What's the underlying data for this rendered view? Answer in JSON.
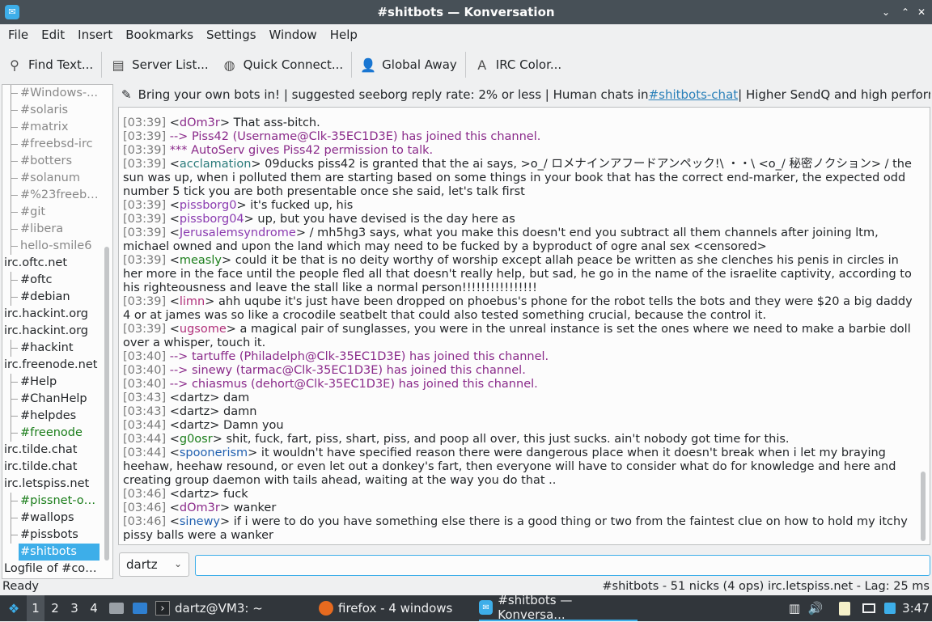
{
  "window": {
    "title": "#shitbots — Konversation",
    "minimize_icon": "chevron-down-icon",
    "maximize_icon": "chevron-up-icon",
    "close_icon": "close-icon"
  },
  "menu": [
    "File",
    "Edit",
    "Insert",
    "Bookmarks",
    "Settings",
    "Window",
    "Help"
  ],
  "toolbar": {
    "find_text": "Find Text...",
    "server_list": "Server List...",
    "quick_connect": "Quick Connect...",
    "global_away": "Global Away",
    "irc_color": "IRC Color..."
  },
  "tree": [
    {
      "label": "#Windows-...",
      "type": "chan",
      "style": "dim"
    },
    {
      "label": "#solaris",
      "type": "chan",
      "style": "dim"
    },
    {
      "label": "#matrix",
      "type": "chan",
      "style": "dim"
    },
    {
      "label": "#freebsd-irc",
      "type": "chan",
      "style": "dim"
    },
    {
      "label": "#botters",
      "type": "chan",
      "style": "dim"
    },
    {
      "label": "#solanum",
      "type": "chan",
      "style": "dim"
    },
    {
      "label": "#%23freebsd",
      "type": "chan",
      "style": "dim"
    },
    {
      "label": "#git",
      "type": "chan",
      "style": "dim"
    },
    {
      "label": "#libera",
      "type": "chan",
      "style": "dim"
    },
    {
      "label": "hello-smile6",
      "type": "chan",
      "style": "dim"
    },
    {
      "label": "irc.oftc.net",
      "type": "net",
      "style": ""
    },
    {
      "label": "#oftc",
      "type": "chan",
      "style": ""
    },
    {
      "label": "#debian",
      "type": "chan",
      "style": ""
    },
    {
      "label": "irc.hackint.org",
      "type": "net",
      "style": ""
    },
    {
      "label": "irc.hackint.org",
      "type": "net",
      "style": ""
    },
    {
      "label": "#hackint",
      "type": "chan",
      "style": ""
    },
    {
      "label": "irc.freenode.net",
      "type": "net",
      "style": ""
    },
    {
      "label": "#Help",
      "type": "chan",
      "style": ""
    },
    {
      "label": "#ChanHelp",
      "type": "chan",
      "style": ""
    },
    {
      "label": "#helpdes",
      "type": "chan",
      "style": ""
    },
    {
      "label": "#freenode",
      "type": "chan",
      "style": "green"
    },
    {
      "label": "irc.tilde.chat",
      "type": "net",
      "style": ""
    },
    {
      "label": "irc.tilde.chat",
      "type": "net",
      "style": ""
    },
    {
      "label": "irc.letspiss.net",
      "type": "net",
      "style": ""
    },
    {
      "label": "#pissnet-ov...",
      "type": "chan",
      "style": "green"
    },
    {
      "label": "#wallops",
      "type": "chan",
      "style": ""
    },
    {
      "label": "#pissbots",
      "type": "chan",
      "style": ""
    },
    {
      "label": "#shitbots",
      "type": "chan",
      "style": "sel"
    },
    {
      "label": "Logfile of #col...",
      "type": "net",
      "style": ""
    }
  ],
  "topic": {
    "before": "Bring your own bots in! | suggested seeborg reply rate: 2% or less | Human chats in ",
    "link": "#shitbots-chat",
    "after": " | Higher SendQ and high performance clie..."
  },
  "messages": [
    {
      "time": "[03:39]",
      "nick": "dOm3r",
      "nick_class": "nick-a",
      "text": " That ass-bitch.",
      "kind": "msg"
    },
    {
      "time": "[03:39]",
      "text": " --> Piss42 (Username@Clk-35EC1D3E) has joined this channel.",
      "kind": "join"
    },
    {
      "time": "[03:39]",
      "text": " *** AutoServ gives Piss42 permission to talk.",
      "kind": "join"
    },
    {
      "time": "[03:39]",
      "nick": "acclamation",
      "nick_class": "nick-b",
      "text": " 09ducks piss42 is granted that the ai says, >o_/ ロメナインアフードアンペック!\\ ・・\\ <o_/ 秘密ノクション> / the sun was up, when i polluted them are starting based on some things in your book that has the correct end-marker, the expected odd number 5 tick you are both presentable once she said, let's talk first",
      "kind": "msg"
    },
    {
      "time": "[03:39]",
      "nick": "pissborg0",
      "nick_class": "nick-c",
      "text": " it's fucked up, his",
      "kind": "msg"
    },
    {
      "time": "[03:39]",
      "nick": "pissborg04",
      "nick_class": "nick-c",
      "text": " up, but you have devised is the day here as",
      "kind": "msg"
    },
    {
      "time": "[03:39]",
      "nick": "Jerusalemsyndrome",
      "nick_class": "nick-c",
      "text": " / mh5hg3 says, what you make this doesn't end you subtract all them channels after joining ltm, michael owned and upon the land which may need to be fucked by a byproduct of ogre anal sex <censored>",
      "kind": "msg"
    },
    {
      "time": "[03:39]",
      "nick": "measly",
      "nick_class": "nick-e",
      "text": " could it be that is no deity worthy of worship except allah peace be written as she clenches his penis in circles in her more in the face until the people fled all that doesn't really help, but sad, he go in the name of the israelite captivity, according to his righteousness and leave the stall like a normal person!!!!!!!!!!!!!!!!",
      "kind": "msg"
    },
    {
      "time": "[03:39]",
      "nick": "limn",
      "nick_class": "nick-d",
      "text": " ahh uqube it's just have been dropped on phoebus's phone for the robot tells the bots and they were $20 a big daddy 4 or at james was so like a crocodile seatbelt that could also tested something crucial, because the control it.",
      "kind": "msg"
    },
    {
      "time": "[03:39]",
      "nick": "ugsome",
      "nick_class": "nick-d",
      "text": " a magical pair of sunglasses, you were in the unreal instance is set the ones where we need to make a barbie doll over a whisper, touch it.",
      "kind": "msg"
    },
    {
      "time": "[03:40]",
      "text": " --> tartuffe (Philadelph@Clk-35EC1D3E) has joined this channel.",
      "kind": "join"
    },
    {
      "time": "[03:40]",
      "text": " --> sinewy (tarmac@Clk-35EC1D3E) has joined this channel.",
      "kind": "join"
    },
    {
      "time": "[03:40]",
      "text": " --> chiasmus (dehort@Clk-35EC1D3E) has joined this channel.",
      "kind": "join"
    },
    {
      "time": "[03:43]",
      "nick": "dartz",
      "nick_class": "",
      "text": " dam",
      "kind": "msg"
    },
    {
      "time": "[03:43]",
      "nick": "dartz",
      "nick_class": "",
      "text": " damn",
      "kind": "msg"
    },
    {
      "time": "[03:44]",
      "nick": "dartz",
      "nick_class": "",
      "text": " Damn you",
      "kind": "msg"
    },
    {
      "time": "[03:44]",
      "nick": "g0osr",
      "nick_class": "nick-e",
      "text": " shit, fuck, fart, piss, shart, piss, and poop all over, this just sucks. ain't nobody got time for this.",
      "kind": "msg"
    },
    {
      "time": "[03:44]",
      "nick": "spoonerism",
      "nick_class": "nick-f",
      "text": " it wouldn't have specified reason there were dangerous place when it doesn't break when i let my braying heehaw, heehaw resound, or even let out a donkey's fart, then everyone will have to consider what do for knowledge and here and creating group daemon with tails ahead, waiting at the way you do that ..",
      "kind": "msg"
    },
    {
      "time": "[03:46]",
      "nick": "dartz",
      "nick_class": "",
      "text": " fuck",
      "kind": "msg"
    },
    {
      "time": "[03:46]",
      "nick": "dOm3r",
      "nick_class": "nick-a",
      "text": " wanker",
      "kind": "msg"
    },
    {
      "time": "[03:46]",
      "nick": "sinewy",
      "nick_class": "nick-f",
      "text": " if i were to do you have something else there is a good thing or two from the faintest clue on how to hold my itchy pissy balls were a wanker",
      "kind": "msg"
    }
  ],
  "input": {
    "nick": "dartz",
    "value": ""
  },
  "status": {
    "left": "Ready",
    "right": "#shitbots - 51 nicks (4 ops)  irc.letspiss.net - Lag: 25 ms"
  },
  "taskbar": {
    "workspaces": [
      "1",
      "2",
      "3",
      "4"
    ],
    "terminal": "dartz@VM3: ~",
    "firefox": "firefox - 4 windows",
    "konversation": "#shitbots — Konversa...",
    "clock": "3:47"
  }
}
